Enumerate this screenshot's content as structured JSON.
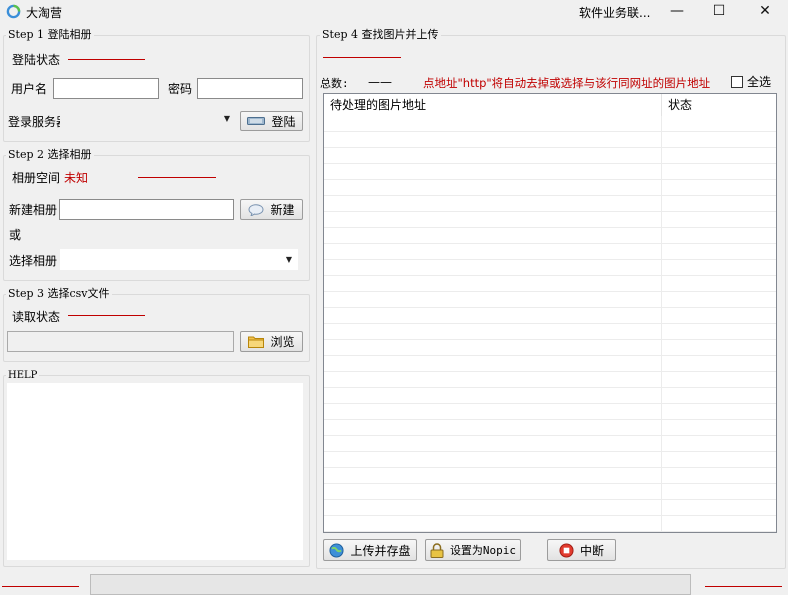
{
  "window": {
    "title": "大淘营",
    "business_link": "软件业务联...",
    "controls": {
      "minimize": "—",
      "maximize": "☐",
      "close": "✕"
    }
  },
  "step1": {
    "legend": "Step 1 登陆相册",
    "login_status_label": "登陆状态",
    "username_label": "用户名",
    "username_value": "",
    "password_label": "密码",
    "password_value": "",
    "server_label": "登录服务器",
    "server_value": "",
    "login_button": "登陆"
  },
  "step2": {
    "legend": "Step 2 选择相册",
    "album_space_label": "相册空间",
    "album_space_value": "未知",
    "new_album_label": "新建相册",
    "new_album_value": "",
    "new_button": "新建",
    "or_label": "或",
    "select_album_label": "选择相册",
    "select_album_value": ""
  },
  "step3": {
    "legend": "Step 3 选择csv文件",
    "read_status_label": "读取状态",
    "file_path_value": "",
    "browse_button": "浏览"
  },
  "help": {
    "legend": "HELP",
    "content": ""
  },
  "step4": {
    "legend": "Step 4 查找图片并上传",
    "total_label": "总数:",
    "total_value": "——",
    "hint": "点地址\"http\"将自动去掉或选择与该行同网址的图片地址",
    "select_all_label": "全选",
    "columns": [
      "待处理的图片地址",
      "状态"
    ],
    "upload_button": "上传并存盘",
    "nopic_button": "设置为Nopic",
    "stop_button": "中断"
  },
  "colors": {
    "accent_red": "#c00000",
    "background": "#f0f0f0"
  }
}
